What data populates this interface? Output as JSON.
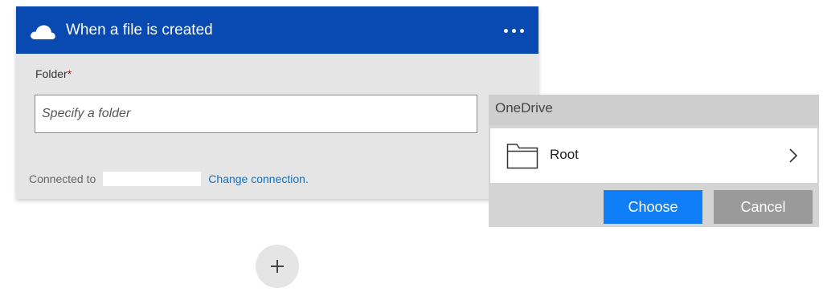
{
  "trigger_card": {
    "title": "When a file is created",
    "header_color": "#094ab2",
    "icon": "cloud-icon",
    "menu_icon": "more-options-icon",
    "folder_field": {
      "label": "Folder",
      "required_mark": "*",
      "placeholder": "Specify a folder",
      "value": ""
    },
    "connection": {
      "label": "Connected to",
      "name": "",
      "change_link": "Change connection."
    }
  },
  "add_step": {
    "icon": "plus-icon"
  },
  "folder_picker": {
    "title": "OneDrive",
    "items": [
      {
        "label": "Root",
        "icon": "folder-icon",
        "trailing_icon": "chevron-right-icon"
      }
    ],
    "choose_label": "Choose",
    "cancel_label": "Cancel",
    "choose_color": "#0f7ef7",
    "cancel_color": "#9a9a9a"
  }
}
